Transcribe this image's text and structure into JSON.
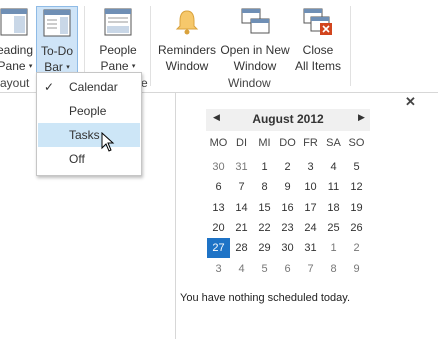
{
  "ribbon": {
    "buttons": [
      {
        "line1": "eading",
        "line2": "Pane",
        "caret": "▾"
      },
      {
        "line1": "To-Do",
        "line2": "Bar",
        "caret": "▾"
      },
      {
        "line1": "People",
        "line2": "Pane",
        "caret": "▾"
      },
      {
        "line1": "Reminders",
        "line2": "Window"
      },
      {
        "line1": "Open in New",
        "line2": "Window"
      },
      {
        "line1": "Close",
        "line2": "All Items"
      }
    ],
    "groups": {
      "layout": "ayout",
      "people_fragment": "e",
      "window": "Window"
    }
  },
  "dropdown": {
    "items": [
      {
        "label": "Calendar",
        "checked": "✓"
      },
      {
        "label": "People"
      },
      {
        "label": "Tasks"
      },
      {
        "label": "Off"
      }
    ]
  },
  "todo": {
    "close_glyph": "✕",
    "calendar": {
      "month": "August 2012",
      "prev": "◀",
      "next": "▶",
      "dow": [
        "MO",
        "DI",
        "MI",
        "DO",
        "FR",
        "SA",
        "SO"
      ],
      "weeks": [
        [
          "30",
          "31",
          "1",
          "2",
          "3",
          "4",
          "5"
        ],
        [
          "6",
          "7",
          "8",
          "9",
          "10",
          "11",
          "12"
        ],
        [
          "13",
          "14",
          "15",
          "16",
          "17",
          "18",
          "19"
        ],
        [
          "20",
          "21",
          "22",
          "23",
          "24",
          "25",
          "26"
        ],
        [
          "27",
          "28",
          "29",
          "30",
          "31",
          "1",
          "2"
        ],
        [
          "3",
          "4",
          "5",
          "6",
          "7",
          "8",
          "9"
        ]
      ],
      "selected": "27"
    },
    "empty_text": "You have nothing scheduled today."
  },
  "colors": {
    "accent": "#1e73c6",
    "highlight": "#cde6f7"
  }
}
